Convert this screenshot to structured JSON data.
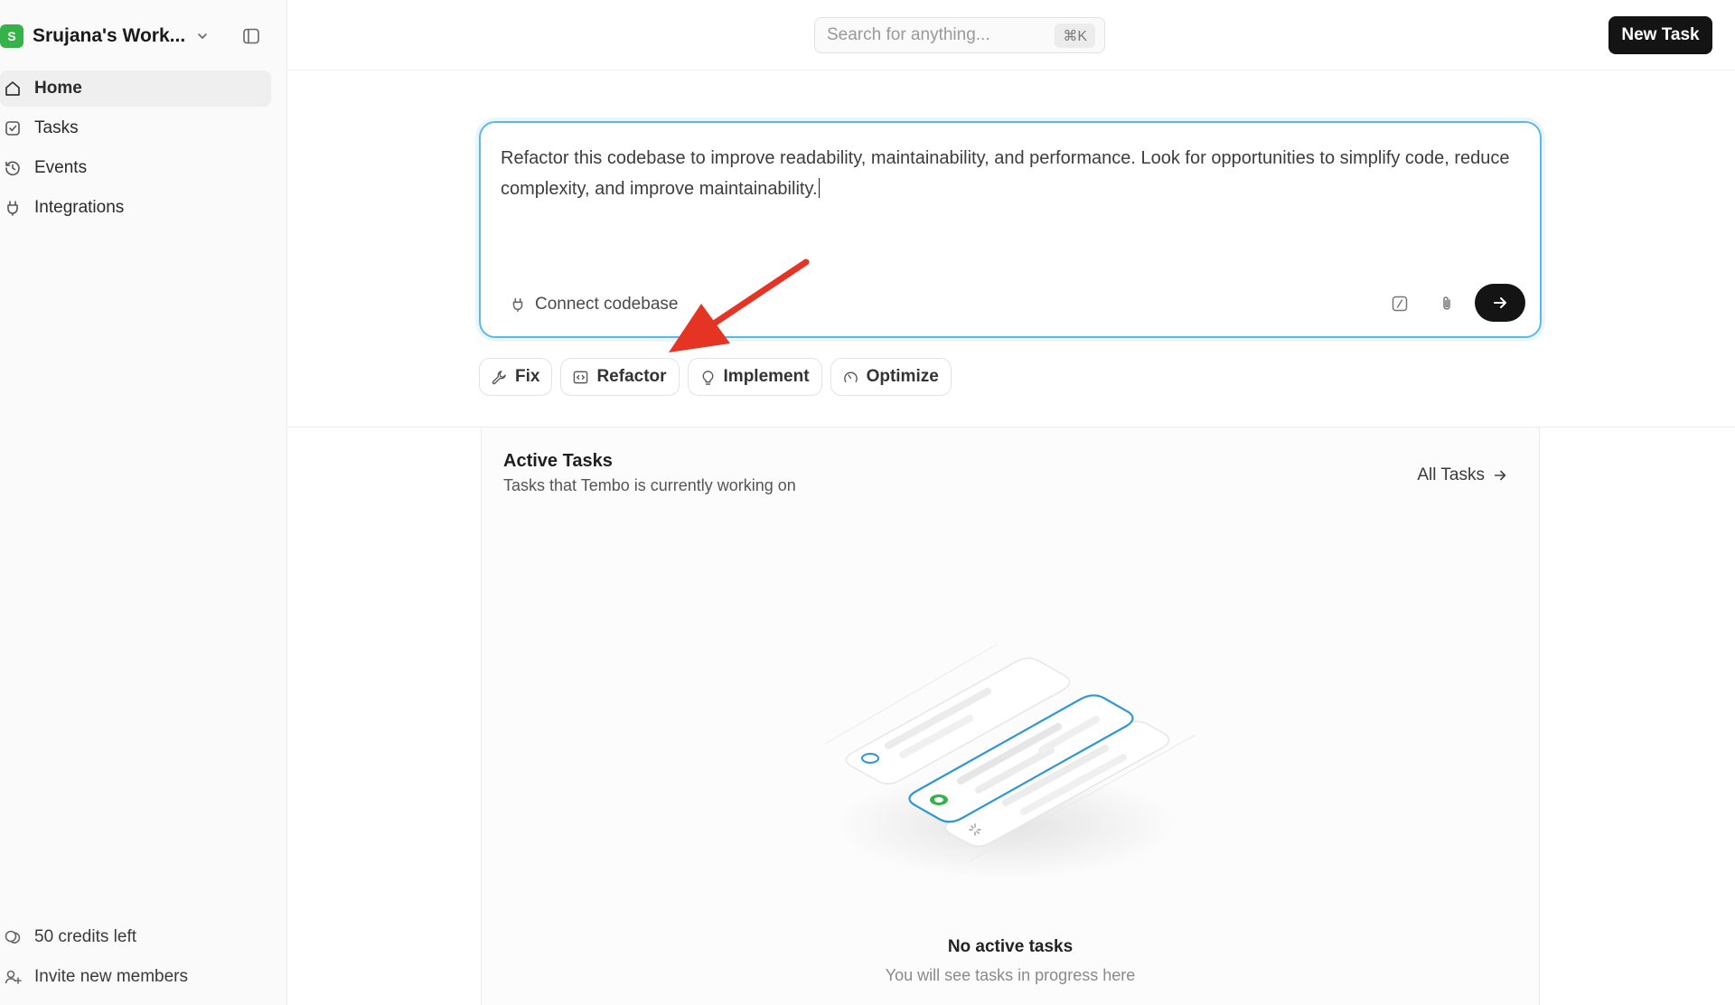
{
  "colors": {
    "accent": "#5ab9ea",
    "workspace_avatar": "#35b24a",
    "annotation_arrow": "#e53423",
    "primary_button": "#141414"
  },
  "sidebar": {
    "workspace": {
      "initial": "S",
      "name": "Srujana's Work...",
      "chevron_icon": "chevron-down-icon",
      "toggle_icon": "sidebar-toggle-icon"
    },
    "nav": [
      {
        "label": "Home",
        "icon": "home-icon",
        "active": true
      },
      {
        "label": "Tasks",
        "icon": "checkbox-icon",
        "active": false
      },
      {
        "label": "Events",
        "icon": "history-icon",
        "active": false
      },
      {
        "label": "Integrations",
        "icon": "plug-icon",
        "active": false
      }
    ],
    "footer": {
      "credits": {
        "label": "50 credits left",
        "icon": "coins-icon"
      },
      "invite": {
        "label": "Invite new members",
        "icon": "user-plus-icon"
      }
    }
  },
  "topbar": {
    "search": {
      "placeholder": "Search for anything...",
      "shortcut": "⌘K"
    },
    "new_task_label": "New Task"
  },
  "prompt": {
    "text": "Refactor this codebase to improve readability, maintainability, and performance. Look for opportunities to simplify code, reduce complexity, and improve maintainability.",
    "connect_label": "Connect codebase",
    "icons": {
      "connect": "plug-icon",
      "slash": "slash-command-icon",
      "attach": "paperclip-icon",
      "send": "arrow-right-icon"
    }
  },
  "chips": [
    {
      "label": "Fix",
      "icon": "wrench-icon"
    },
    {
      "label": "Refactor",
      "icon": "code-square-icon"
    },
    {
      "label": "Implement",
      "icon": "lightbulb-icon"
    },
    {
      "label": "Optimize",
      "icon": "gauge-icon"
    }
  ],
  "active_tasks": {
    "title": "Active Tasks",
    "subtitle": "Tasks that Tembo is currently working on",
    "all_tasks_label": "All Tasks",
    "empty_title": "No active tasks",
    "empty_subtitle": "You will see tasks in progress here"
  }
}
